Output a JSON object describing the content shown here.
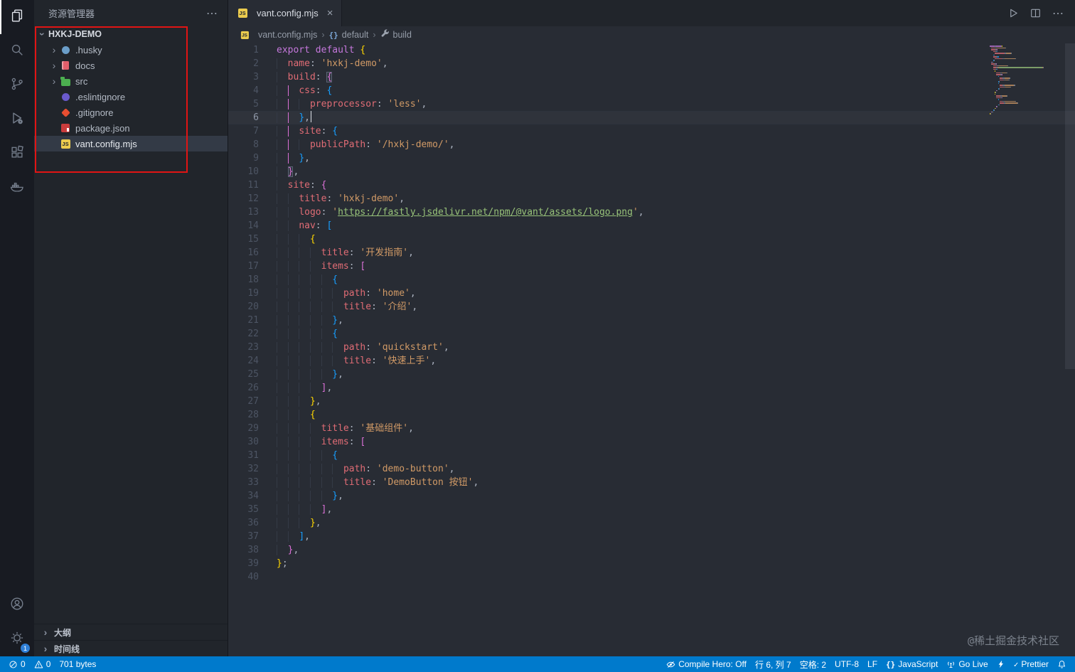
{
  "palette": {
    "editor_bg": "#282c34",
    "sidebar_bg": "#21252b",
    "activitybar_bg": "#181b22",
    "statusbar_bg": "#007acc",
    "accent_red_annotation": "#e11414",
    "keyword": "#c678dd",
    "property": "#e06c75",
    "string": "#d19a66",
    "link": "#98c379",
    "bracket1": "#ffd700",
    "bracket2": "#da70d6",
    "bracket3": "#179fff"
  },
  "activity_bar": {
    "items": [
      {
        "icon": "explorer-icon",
        "active": true
      },
      {
        "icon": "search-icon"
      },
      {
        "icon": "source-control-icon"
      },
      {
        "icon": "run-debug-icon"
      },
      {
        "icon": "extensions-icon"
      },
      {
        "icon": "docker-icon"
      }
    ],
    "bottom": [
      {
        "icon": "account-icon"
      },
      {
        "icon": "settings-gear-icon",
        "badge": "1"
      }
    ]
  },
  "sidebar": {
    "title": "资源管理器",
    "root": {
      "label": "HXKJ-DEMO",
      "expanded": true
    },
    "items": [
      {
        "label": ".husky",
        "kind": "folder",
        "icon": "husky-folder-icon"
      },
      {
        "label": "docs",
        "kind": "folder",
        "icon": "docs-folder-icon"
      },
      {
        "label": "src",
        "kind": "folder",
        "icon": "src-folder-icon"
      },
      {
        "label": ".eslintignore",
        "kind": "file",
        "icon": "eslint-icon"
      },
      {
        "label": ".gitignore",
        "kind": "file",
        "icon": "git-icon"
      },
      {
        "label": "package.json",
        "kind": "file",
        "icon": "npm-icon"
      },
      {
        "label": "vant.config.mjs",
        "kind": "file",
        "icon": "js-icon",
        "selected": true
      }
    ],
    "panels": [
      {
        "label": "大纲"
      },
      {
        "label": "时间线"
      }
    ]
  },
  "editor": {
    "tab": {
      "label": "vant.config.mjs",
      "icon": "js-icon"
    },
    "actions": [
      {
        "icon": "play-icon"
      },
      {
        "icon": "split-editor-icon"
      },
      {
        "icon": "ellipsis-icon"
      }
    ],
    "breadcrumb": [
      {
        "icon": "js-badge-icon",
        "label": "vant.config.mjs"
      },
      {
        "icon": "namespace-icon",
        "label": "default"
      },
      {
        "icon": "wrench-icon",
        "label": "build"
      }
    ],
    "cursor_position": {
      "line": 6,
      "column": 7
    },
    "lines": [
      {
        "n": 1,
        "g": [],
        "t": [
          [
            "kw",
            "export"
          ],
          [
            "pu",
            " "
          ],
          [
            "kw",
            "default"
          ],
          [
            "pu",
            " "
          ],
          [
            "b1",
            "{"
          ]
        ]
      },
      {
        "n": 2,
        "g": [
          "g"
        ],
        "t": [
          [
            "pr",
            "name"
          ],
          [
            "pu",
            ": "
          ],
          [
            "st",
            "'hxkj-demo'"
          ],
          [
            "pu",
            ","
          ]
        ]
      },
      {
        "n": 3,
        "g": [
          "g"
        ],
        "t": [
          [
            "pr",
            "build"
          ],
          [
            "pu",
            ": "
          ],
          [
            "b2",
            "{",
            "m"
          ]
        ]
      },
      {
        "n": 4,
        "g": [
          "g",
          "p"
        ],
        "t": [
          [
            "pr",
            "css"
          ],
          [
            "pu",
            ": "
          ],
          [
            "b3",
            "{"
          ]
        ]
      },
      {
        "n": 5,
        "g": [
          "g",
          "p",
          "g"
        ],
        "t": [
          [
            "pr",
            "preprocessor"
          ],
          [
            "pu",
            ": "
          ],
          [
            "st",
            "'less'"
          ],
          [
            "pu",
            ","
          ]
        ]
      },
      {
        "n": 6,
        "g": [
          "g",
          "p"
        ],
        "cur": true,
        "t": [
          [
            "b3",
            "}"
          ],
          [
            "pu",
            ","
          ],
          [
            "cursor",
            ""
          ]
        ]
      },
      {
        "n": 7,
        "g": [
          "g",
          "p"
        ],
        "t": [
          [
            "pr",
            "site"
          ],
          [
            "pu",
            ": "
          ],
          [
            "b3",
            "{"
          ]
        ]
      },
      {
        "n": 8,
        "g": [
          "g",
          "p",
          "g"
        ],
        "t": [
          [
            "pr",
            "publicPath"
          ],
          [
            "pu",
            ": "
          ],
          [
            "st",
            "'/hxkj-demo/'"
          ],
          [
            "pu",
            ","
          ]
        ]
      },
      {
        "n": 9,
        "g": [
          "g",
          "p"
        ],
        "t": [
          [
            "b3",
            "}"
          ],
          [
            "pu",
            ","
          ]
        ]
      },
      {
        "n": 10,
        "g": [
          "g"
        ],
        "t": [
          [
            "b2",
            "}",
            "m"
          ],
          [
            "pu",
            ","
          ]
        ]
      },
      {
        "n": 11,
        "g": [
          "g"
        ],
        "t": [
          [
            "pr",
            "site"
          ],
          [
            "pu",
            ": "
          ],
          [
            "b2",
            "{"
          ]
        ]
      },
      {
        "n": 12,
        "g": [
          "g",
          "g"
        ],
        "t": [
          [
            "pr",
            "title"
          ],
          [
            "pu",
            ": "
          ],
          [
            "st",
            "'hxkj-demo'"
          ],
          [
            "pu",
            ","
          ]
        ]
      },
      {
        "n": 13,
        "g": [
          "g",
          "g"
        ],
        "t": [
          [
            "pr",
            "logo"
          ],
          [
            "pu",
            ": "
          ],
          [
            "st",
            "'"
          ],
          [
            "lk",
            "https://fastly.jsdelivr.net/npm/@vant/assets/logo.png"
          ],
          [
            "st",
            "'"
          ],
          [
            "pu",
            ","
          ]
        ]
      },
      {
        "n": 14,
        "g": [
          "g",
          "g"
        ],
        "t": [
          [
            "pr",
            "nav"
          ],
          [
            "pu",
            ": "
          ],
          [
            "b3",
            "["
          ]
        ]
      },
      {
        "n": 15,
        "g": [
          "g",
          "g",
          "g"
        ],
        "t": [
          [
            "b1",
            "{"
          ]
        ]
      },
      {
        "n": 16,
        "g": [
          "g",
          "g",
          "g",
          "g"
        ],
        "t": [
          [
            "pr",
            "title"
          ],
          [
            "pu",
            ": "
          ],
          [
            "st",
            "'开发指南'"
          ],
          [
            "pu",
            ","
          ]
        ]
      },
      {
        "n": 17,
        "g": [
          "g",
          "g",
          "g",
          "g"
        ],
        "t": [
          [
            "pr",
            "items"
          ],
          [
            "pu",
            ": "
          ],
          [
            "b2",
            "["
          ]
        ]
      },
      {
        "n": 18,
        "g": [
          "g",
          "g",
          "g",
          "g",
          "g"
        ],
        "t": [
          [
            "b3",
            "{"
          ]
        ]
      },
      {
        "n": 19,
        "g": [
          "g",
          "g",
          "g",
          "g",
          "g",
          "g"
        ],
        "t": [
          [
            "pr",
            "path"
          ],
          [
            "pu",
            ": "
          ],
          [
            "st",
            "'home'"
          ],
          [
            "pu",
            ","
          ]
        ]
      },
      {
        "n": 20,
        "g": [
          "g",
          "g",
          "g",
          "g",
          "g",
          "g"
        ],
        "t": [
          [
            "pr",
            "title"
          ],
          [
            "pu",
            ": "
          ],
          [
            "st",
            "'介绍'"
          ],
          [
            "pu",
            ","
          ]
        ]
      },
      {
        "n": 21,
        "g": [
          "g",
          "g",
          "g",
          "g",
          "g"
        ],
        "t": [
          [
            "b3",
            "}"
          ],
          [
            "pu",
            ","
          ]
        ]
      },
      {
        "n": 22,
        "g": [
          "g",
          "g",
          "g",
          "g",
          "g"
        ],
        "t": [
          [
            "b3",
            "{"
          ]
        ]
      },
      {
        "n": 23,
        "g": [
          "g",
          "g",
          "g",
          "g",
          "g",
          "g"
        ],
        "t": [
          [
            "pr",
            "path"
          ],
          [
            "pu",
            ": "
          ],
          [
            "st",
            "'quickstart'"
          ],
          [
            "pu",
            ","
          ]
        ]
      },
      {
        "n": 24,
        "g": [
          "g",
          "g",
          "g",
          "g",
          "g",
          "g"
        ],
        "t": [
          [
            "pr",
            "title"
          ],
          [
            "pu",
            ": "
          ],
          [
            "st",
            "'快速上手'"
          ],
          [
            "pu",
            ","
          ]
        ]
      },
      {
        "n": 25,
        "g": [
          "g",
          "g",
          "g",
          "g",
          "g"
        ],
        "t": [
          [
            "b3",
            "}"
          ],
          [
            "pu",
            ","
          ]
        ]
      },
      {
        "n": 26,
        "g": [
          "g",
          "g",
          "g",
          "g"
        ],
        "t": [
          [
            "b2",
            "]"
          ],
          [
            "pu",
            ","
          ]
        ]
      },
      {
        "n": 27,
        "g": [
          "g",
          "g",
          "g"
        ],
        "t": [
          [
            "b1",
            "}"
          ],
          [
            "pu",
            ","
          ]
        ]
      },
      {
        "n": 28,
        "g": [
          "g",
          "g",
          "g"
        ],
        "t": [
          [
            "b1",
            "{"
          ]
        ]
      },
      {
        "n": 29,
        "g": [
          "g",
          "g",
          "g",
          "g"
        ],
        "t": [
          [
            "pr",
            "title"
          ],
          [
            "pu",
            ": "
          ],
          [
            "st",
            "'基础组件'"
          ],
          [
            "pu",
            ","
          ]
        ]
      },
      {
        "n": 30,
        "g": [
          "g",
          "g",
          "g",
          "g"
        ],
        "t": [
          [
            "pr",
            "items"
          ],
          [
            "pu",
            ": "
          ],
          [
            "b2",
            "["
          ]
        ]
      },
      {
        "n": 31,
        "g": [
          "g",
          "g",
          "g",
          "g",
          "g"
        ],
        "t": [
          [
            "b3",
            "{"
          ]
        ]
      },
      {
        "n": 32,
        "g": [
          "g",
          "g",
          "g",
          "g",
          "g",
          "g"
        ],
        "t": [
          [
            "pr",
            "path"
          ],
          [
            "pu",
            ": "
          ],
          [
            "st",
            "'demo-button'"
          ],
          [
            "pu",
            ","
          ]
        ]
      },
      {
        "n": 33,
        "g": [
          "g",
          "g",
          "g",
          "g",
          "g",
          "g"
        ],
        "t": [
          [
            "pr",
            "title"
          ],
          [
            "pu",
            ": "
          ],
          [
            "st",
            "'DemoButton 按钮'"
          ],
          [
            "pu",
            ","
          ]
        ]
      },
      {
        "n": 34,
        "g": [
          "g",
          "g",
          "g",
          "g",
          "g"
        ],
        "t": [
          [
            "b3",
            "}"
          ],
          [
            "pu",
            ","
          ]
        ]
      },
      {
        "n": 35,
        "g": [
          "g",
          "g",
          "g",
          "g"
        ],
        "t": [
          [
            "b2",
            "]"
          ],
          [
            "pu",
            ","
          ]
        ]
      },
      {
        "n": 36,
        "g": [
          "g",
          "g",
          "g"
        ],
        "t": [
          [
            "b1",
            "}"
          ],
          [
            "pu",
            ","
          ]
        ]
      },
      {
        "n": 37,
        "g": [
          "g",
          "g"
        ],
        "t": [
          [
            "b3",
            "]"
          ],
          [
            "pu",
            ","
          ]
        ]
      },
      {
        "n": 38,
        "g": [
          "g"
        ],
        "t": [
          [
            "b2",
            "}"
          ],
          [
            "pu",
            ","
          ]
        ]
      },
      {
        "n": 39,
        "g": [],
        "t": [
          [
            "b1",
            "}"
          ],
          [
            "pu",
            ";"
          ]
        ]
      },
      {
        "n": 40,
        "g": [],
        "t": []
      }
    ]
  },
  "status_bar": {
    "left": [
      {
        "icon": "error-icon",
        "label": "0"
      },
      {
        "icon": "warning-icon",
        "label": "0"
      },
      {
        "label": "701 bytes"
      }
    ],
    "right": [
      {
        "icon": "eye-slash-icon",
        "label": "Compile Hero: Off"
      },
      {
        "label": "行 6, 列 7"
      },
      {
        "label": "空格: 2"
      },
      {
        "label": "UTF-8"
      },
      {
        "label": "LF"
      },
      {
        "icon": "braces-icon",
        "label": "JavaScript"
      },
      {
        "icon": "broadcast-icon",
        "label": "Go Live"
      },
      {
        "icon": "lightning-icon",
        "label": ""
      },
      {
        "icon": "check-icon",
        "label": "Prettier"
      },
      {
        "icon": "bell-icon",
        "label": ""
      }
    ]
  },
  "watermark": "@稀土掘金技术社区"
}
